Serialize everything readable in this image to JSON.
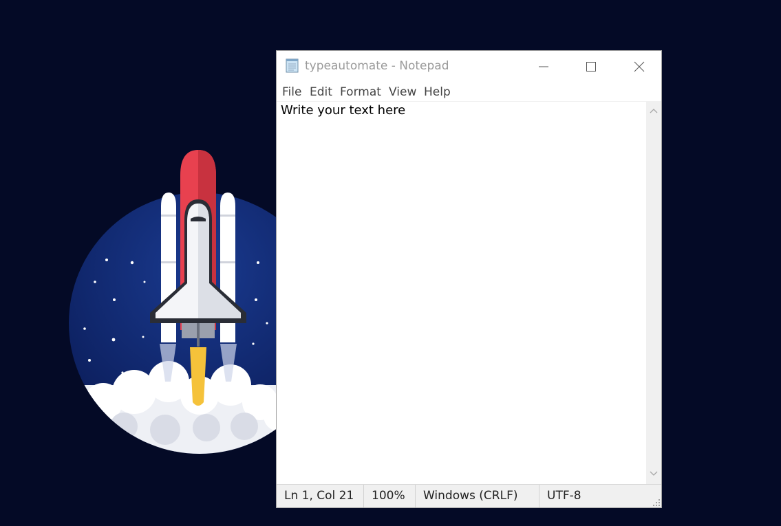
{
  "window": {
    "title": "typeautomate - Notepad",
    "app_icon": "notepad-icon"
  },
  "menu": [
    "File",
    "Edit",
    "Format",
    "View",
    "Help"
  ],
  "editor": {
    "text": "Write your text here"
  },
  "status": {
    "position": "Ln 1, Col 21",
    "zoom": "100%",
    "line_ending": "Windows (CRLF)",
    "encoding": "UTF-8"
  },
  "colors": {
    "desktop_background": "#040a26",
    "rocket_nose": "#e8414f",
    "flame": "#f5c23a"
  }
}
